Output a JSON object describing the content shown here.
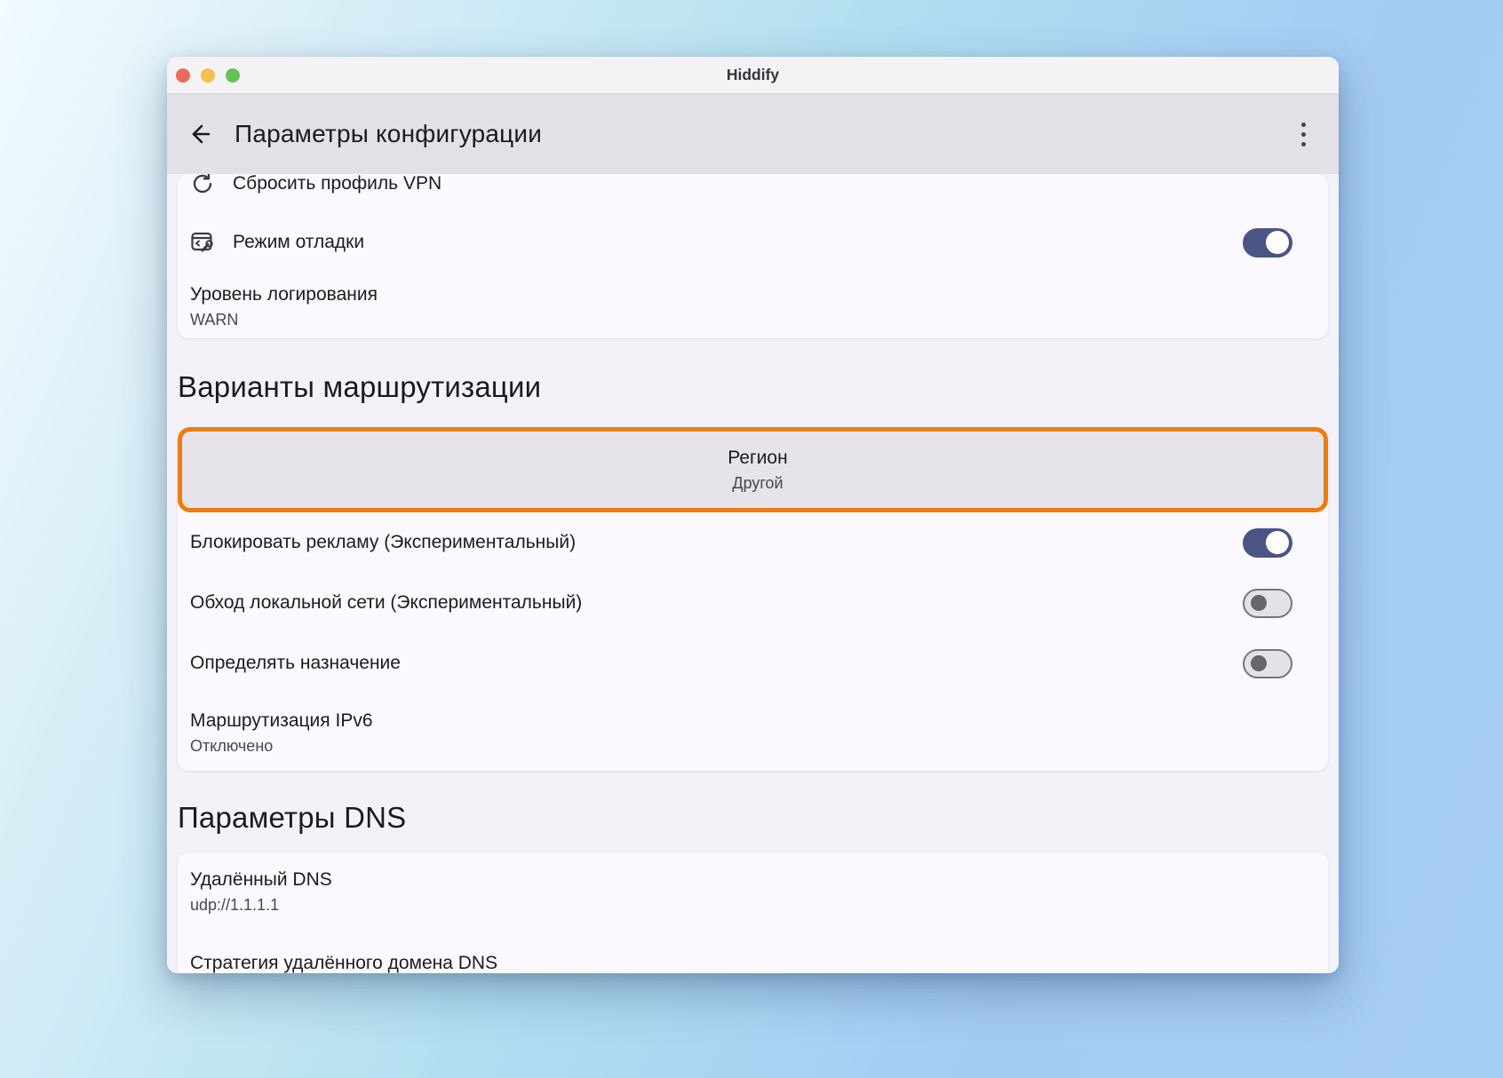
{
  "window": {
    "title": "Hiddify",
    "controls": [
      "close",
      "minimize",
      "zoom"
    ]
  },
  "appbar": {
    "title": "Параметры конфигурации",
    "back_icon": "back-arrow-icon",
    "menu_icon": "kebab-menu-icon"
  },
  "top_card": {
    "rows": [
      {
        "title": "Сбросить профиль VPN",
        "icon": "refresh-icon",
        "clipped": true
      },
      {
        "title": "Режим отладки",
        "icon": "debug-console-icon",
        "toggle": "on"
      },
      {
        "title": "Уровень логирования",
        "subtitle": "WARN"
      }
    ]
  },
  "routing": {
    "header": "Варианты маршрутизации",
    "rows": [
      {
        "title": "Регион",
        "subtitle": "Другой",
        "highlighted": true
      },
      {
        "title": "Блокировать рекламу (Экспериментальный)",
        "toggle": "on"
      },
      {
        "title": "Обход локальной сети (Экспериментальный)",
        "toggle": "off"
      },
      {
        "title": "Определять назначение",
        "toggle": "off"
      },
      {
        "title": "Маршрутизация IPv6",
        "subtitle": "Отключено"
      }
    ]
  },
  "dns": {
    "header": "Параметры DNS",
    "rows": [
      {
        "title": "Удалённый DNS",
        "subtitle": "udp://1.1.1.1"
      },
      {
        "title": "Стратегия удалённого домена DNS",
        "clipped": true
      }
    ]
  },
  "colors": {
    "toggle_on": "#4a5585",
    "highlight_border": "#ee7d11",
    "traffic_red": "#ed6a5e",
    "traffic_yellow": "#f5bf4f",
    "traffic_green": "#62c454"
  }
}
